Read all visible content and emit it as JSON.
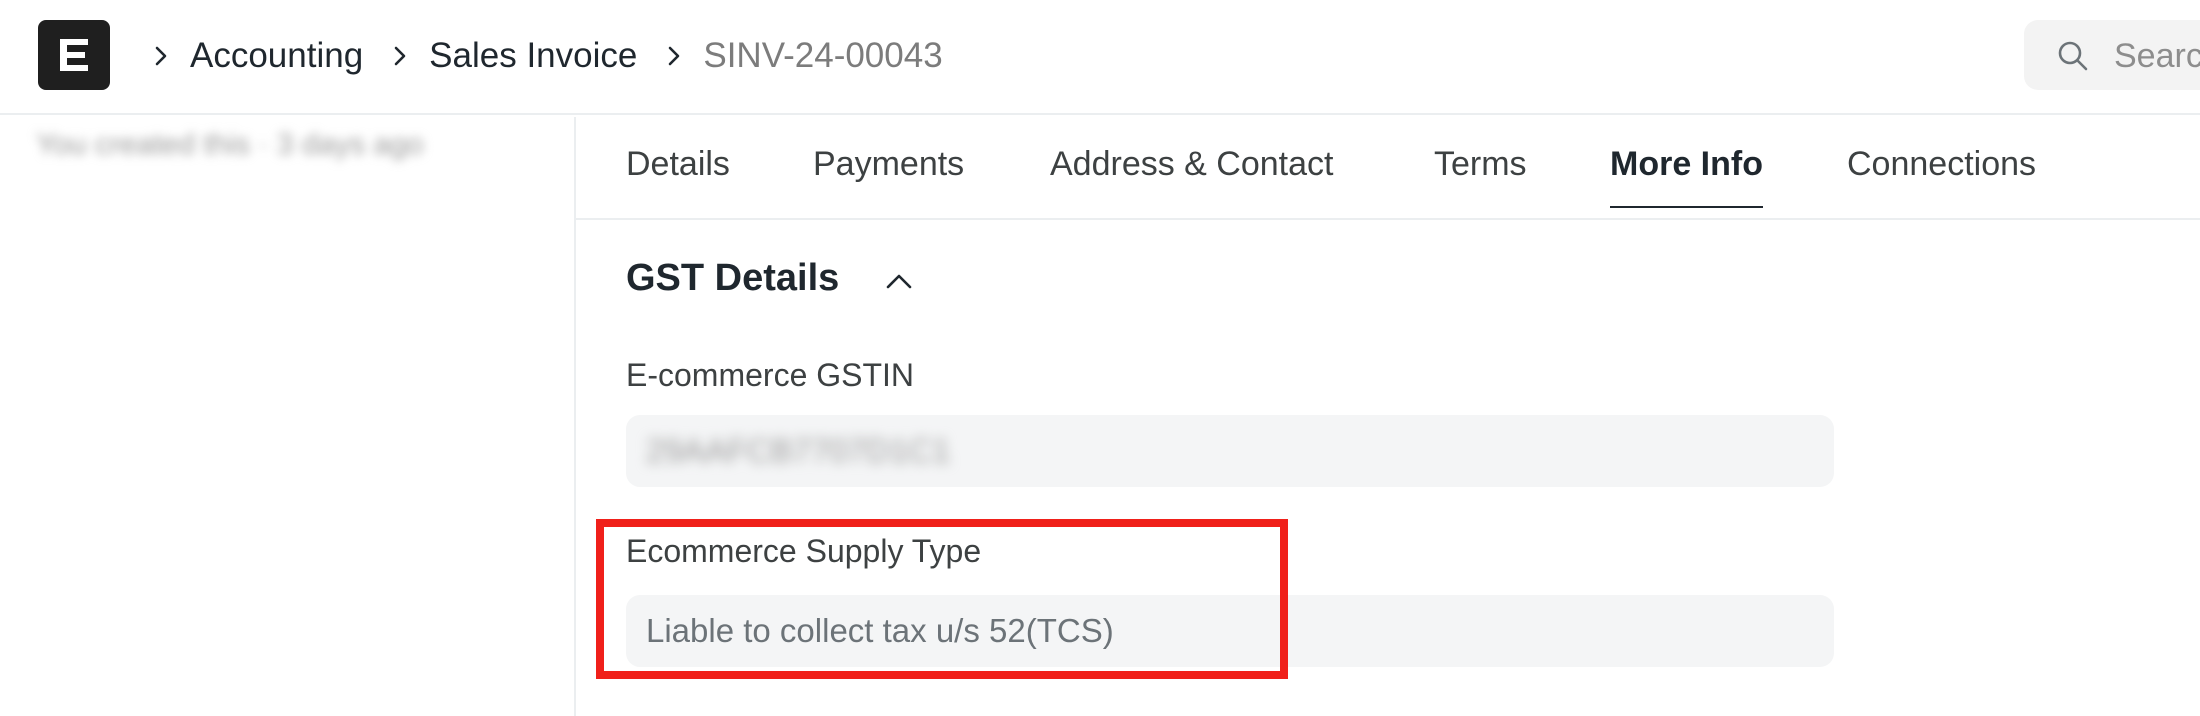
{
  "header": {
    "logo_letter": "E",
    "breadcrumbs": [
      "Accounting",
      "Sales Invoice",
      "SINV-24-00043"
    ],
    "search_placeholder": "Search"
  },
  "sidebar": {
    "timeline_text": "You created this · 3 days ago"
  },
  "tabs": [
    {
      "label": "Details",
      "active": false
    },
    {
      "label": "Payments",
      "active": false
    },
    {
      "label": "Address & Contact",
      "active": false
    },
    {
      "label": "Terms",
      "active": false
    },
    {
      "label": "More Info",
      "active": true
    },
    {
      "label": "Connections",
      "active": false
    }
  ],
  "section": {
    "title": "GST Details",
    "fields": [
      {
        "label": "E-commerce GSTIN",
        "value": "29AAFCB7707D1C1"
      },
      {
        "label": "Ecommerce Supply Type",
        "value": "Liable to collect tax u/s 52(TCS)"
      }
    ]
  },
  "colors": {
    "highlight": "#f0201a",
    "logo_bg": "#1f1f1f",
    "input_bg": "#f4f5f6"
  }
}
